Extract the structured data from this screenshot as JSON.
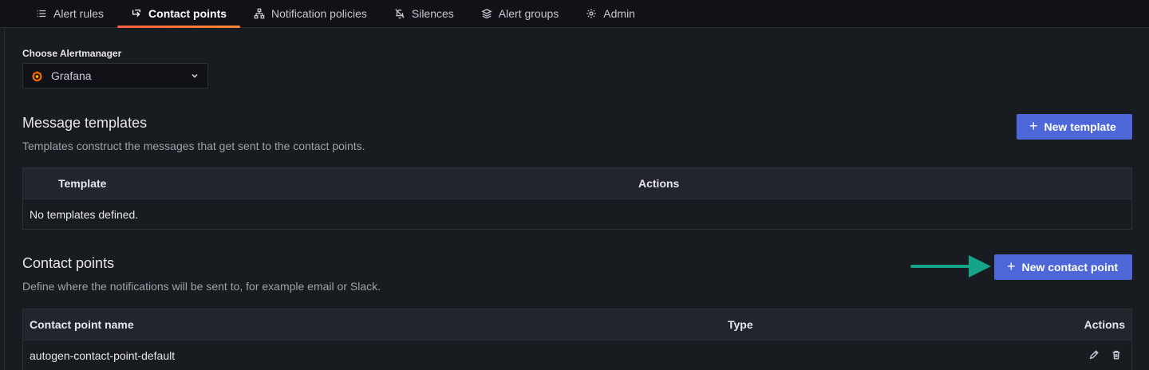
{
  "tabs": [
    {
      "label": "Alert rules",
      "icon": "list-icon"
    },
    {
      "label": "Contact points",
      "icon": "comment-alt-share-icon"
    },
    {
      "label": "Notification policies",
      "icon": "sitemap-icon"
    },
    {
      "label": "Silences",
      "icon": "bell-slash-icon"
    },
    {
      "label": "Alert groups",
      "icon": "layer-group-icon"
    },
    {
      "label": "Admin",
      "icon": "gear-icon"
    }
  ],
  "active_tab": "Contact points",
  "alertmanager": {
    "label": "Choose Alertmanager",
    "selected": "Grafana"
  },
  "templates": {
    "title": "Message templates",
    "description": "Templates construct the messages that get sent to the contact points.",
    "new_button": "New template",
    "columns": [
      "Template",
      "Actions"
    ],
    "empty_text": "No templates defined."
  },
  "contact_points": {
    "title": "Contact points",
    "description": "Define where the notifications will be sent to, for example email or Slack.",
    "new_button": "New contact point",
    "columns": [
      "Contact point name",
      "Type",
      "Actions"
    ],
    "rows": [
      {
        "name": "autogen-contact-point-default",
        "type": ""
      }
    ]
  },
  "colors": {
    "primary_button": "#4d67d9",
    "active_tab_accent": "#f55f3e",
    "annotation_arrow": "#15a38a"
  }
}
